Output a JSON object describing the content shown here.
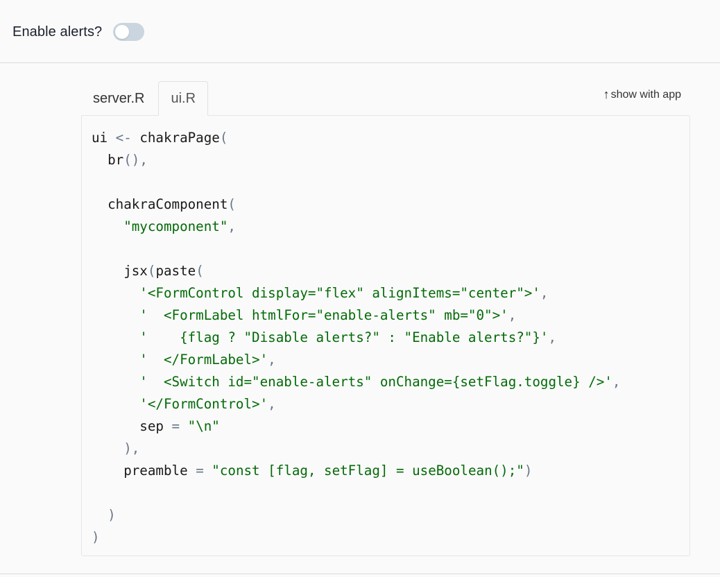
{
  "app": {
    "label": "Enable alerts?",
    "switch_checked": false
  },
  "tabs": [
    {
      "label": "server.R",
      "active": false
    },
    {
      "label": "ui.R",
      "active": true
    }
  ],
  "show_with_app": {
    "icon": "arrow-up-icon",
    "label": "show with app"
  },
  "colors": {
    "string": "#036a07",
    "punctuation": "#687687",
    "switch_off": "#cbd5e0"
  },
  "code_lines": [
    [
      [
        "id",
        "ui "
      ],
      [
        "op",
        "<-"
      ],
      [
        "id",
        " chakraPage"
      ],
      [
        "p",
        "("
      ]
    ],
    [
      [
        "id",
        "  br"
      ],
      [
        "p",
        "(),"
      ]
    ],
    [],
    [
      [
        "id",
        "  chakraComponent"
      ],
      [
        "p",
        "("
      ]
    ],
    [
      [
        "str",
        "    \"mycomponent\""
      ],
      [
        "p",
        ","
      ]
    ],
    [],
    [
      [
        "id",
        "    jsx"
      ],
      [
        "p",
        "("
      ],
      [
        "id",
        "paste"
      ],
      [
        "p",
        "("
      ]
    ],
    [
      [
        "str",
        "      '<FormControl display=\"flex\" alignItems=\"center\">'"
      ],
      [
        "p",
        ","
      ]
    ],
    [
      [
        "str",
        "      '  <FormLabel htmlFor=\"enable-alerts\" mb=\"0\">'"
      ],
      [
        "p",
        ","
      ]
    ],
    [
      [
        "str",
        "      '    {flag ? \"Disable alerts?\" : \"Enable alerts?\"}'"
      ],
      [
        "p",
        ","
      ]
    ],
    [
      [
        "str",
        "      '  </FormLabel>'"
      ],
      [
        "p",
        ","
      ]
    ],
    [
      [
        "str",
        "      '  <Switch id=\"enable-alerts\" onChange={setFlag.toggle} />'"
      ],
      [
        "p",
        ","
      ]
    ],
    [
      [
        "str",
        "      '</FormControl>'"
      ],
      [
        "p",
        ","
      ]
    ],
    [
      [
        "id",
        "      sep "
      ],
      [
        "op",
        "="
      ],
      [
        "str",
        " \"\\n\""
      ]
    ],
    [
      [
        "p",
        "    ),"
      ]
    ],
    [
      [
        "id",
        "    preamble "
      ],
      [
        "op",
        "="
      ],
      [
        "str",
        " \"const [flag, setFlag] = useBoolean();\""
      ],
      [
        "p",
        ")"
      ]
    ],
    [],
    [
      [
        "p",
        "  )"
      ]
    ],
    [
      [
        "p",
        ")"
      ]
    ]
  ]
}
